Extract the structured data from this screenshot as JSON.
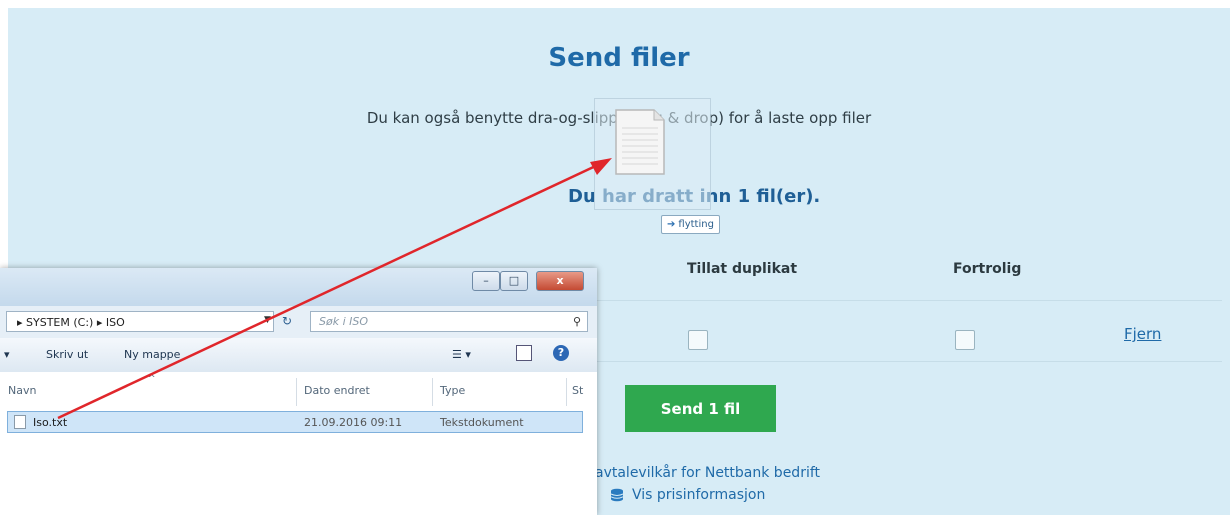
{
  "web": {
    "title": "Send filer",
    "subtitle": "Du kan også benytte dra-og-slipp (drag & drop) for å laste opp filer",
    "status": "Du har dratt inn 1 fil(er).",
    "columns": [
      "Tillat duplikat",
      "Fortrolig"
    ],
    "remove_link": "Fjern",
    "send_button": "Send 1 fil",
    "terms_link": "avtalevilkår for Nettbank bedrift",
    "price_link": "Vis prisinformasjon"
  },
  "drag": {
    "badge": "flytting"
  },
  "explorer": {
    "window_buttons": {
      "minimize": "–",
      "maximize": "□",
      "close": "x"
    },
    "breadcrumb": "▸ SYSTEM (C:) ▸ ISO",
    "search_placeholder": "Søk i ISO",
    "toolbar": {
      "print": "Skriv ut",
      "new_folder": "Ny mappe"
    },
    "columns": {
      "name": "Navn",
      "date": "Dato endret",
      "type": "Type",
      "size": "St"
    },
    "files": [
      {
        "name": "Iso.txt",
        "date": "21.09.2016 09:11",
        "type": "Tekstdokument"
      }
    ]
  },
  "colors": {
    "accent": "#1f6aa8",
    "send_button": "#2fa84f",
    "panel_bg": "#d7ecf6",
    "arrow": "#e0262b"
  },
  "icons": [
    "file-icon",
    "drag-file-icon",
    "move-arrow-icon",
    "database-icon",
    "search-icon",
    "refresh-icon",
    "help-icon",
    "view-options-icon",
    "preview-pane-icon"
  ]
}
